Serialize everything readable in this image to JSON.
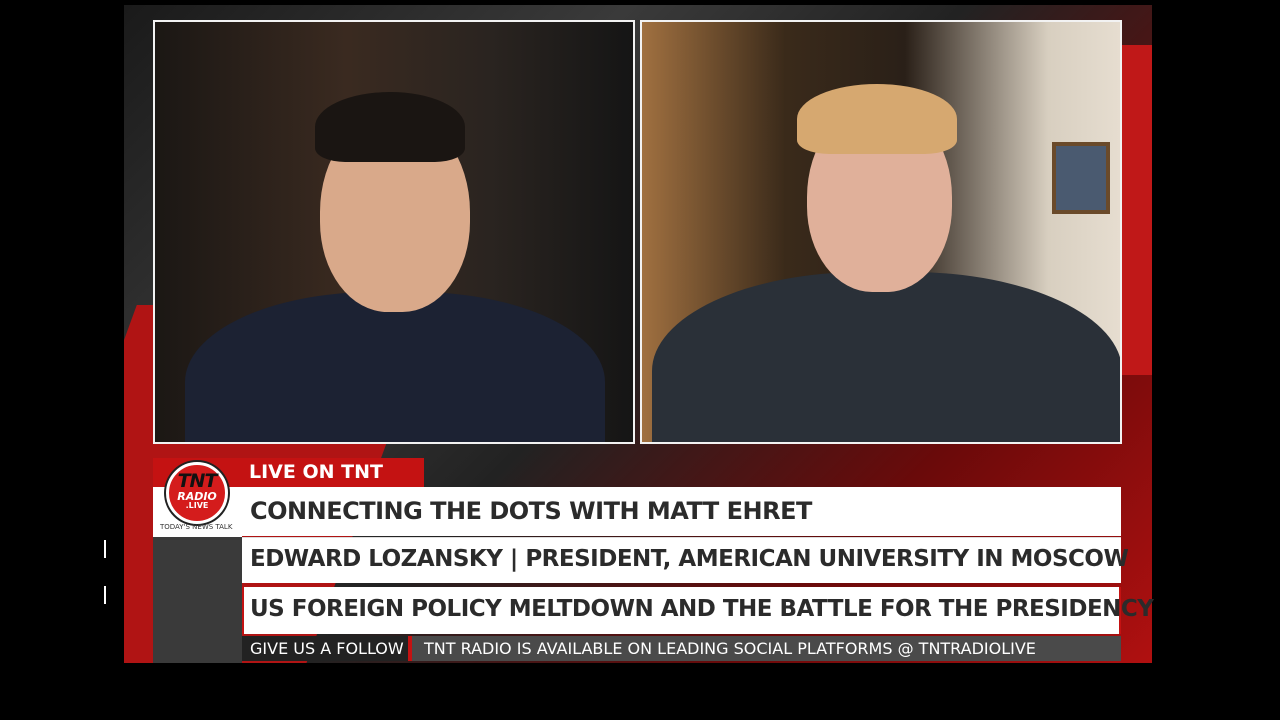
{
  "branding": {
    "live_label": "LIVE ON TNT",
    "logo_text": "TNT",
    "logo_sub": "RADIO",
    "logo_domain": ".LIVE",
    "tagline": "TODAY'S NEWS TALK",
    "accent": "#c41212"
  },
  "lower_third": {
    "show_title": "CONNECTING THE DOTS WITH MATT EHRET",
    "guest": "EDWARD LOZANSKY | PRESIDENT, AMERICAN UNIVERSITY IN MOSCOW",
    "topic": "US FOREIGN POLICY MELTDOWN AND THE BATTLE FOR THE PRESIDENCY"
  },
  "ticker": {
    "label": "GIVE US A FOLLOW",
    "text": "TNT RADIO IS AVAILABLE ON LEADING SOCIAL PLATFORMS @ TNTRADIOLIVE"
  }
}
